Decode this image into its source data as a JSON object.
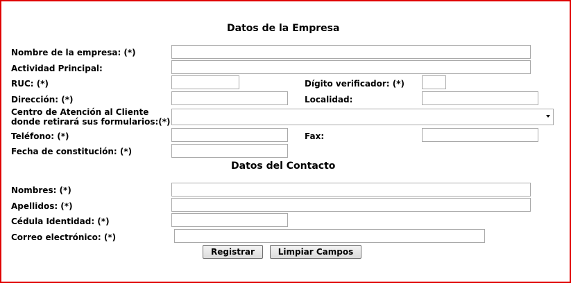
{
  "company_section": {
    "title": "Datos de la Empresa",
    "company_name_label": "Nombre de la empresa: (*)",
    "main_activity_label": "Actividad Principal:",
    "ruc_label": "RUC: (*)",
    "check_digit_label": "Dígito verificador: (*)",
    "address_label": "Dirección: (*)",
    "locality_label": "Localidad:",
    "service_center_label_line1": "Centro de Atención al Cliente",
    "service_center_label_line2": "donde retirará sus formularios:(*)",
    "phone_label": "Teléfono: (*)",
    "fax_label": "Fax:",
    "founding_date_label": "Fecha de constitución: (*)"
  },
  "contact_section": {
    "title": "Datos del Contacto",
    "first_names_label": "Nombres: (*)",
    "last_names_label": "Apellidos: (*)",
    "id_card_label": "Cédula Identidad: (*)",
    "email_label": "Correo electrónico: (*)"
  },
  "buttons": {
    "register": "Registrar",
    "clear": "Limpiar Campos"
  },
  "colors": {
    "frame_border": "#e00000"
  }
}
